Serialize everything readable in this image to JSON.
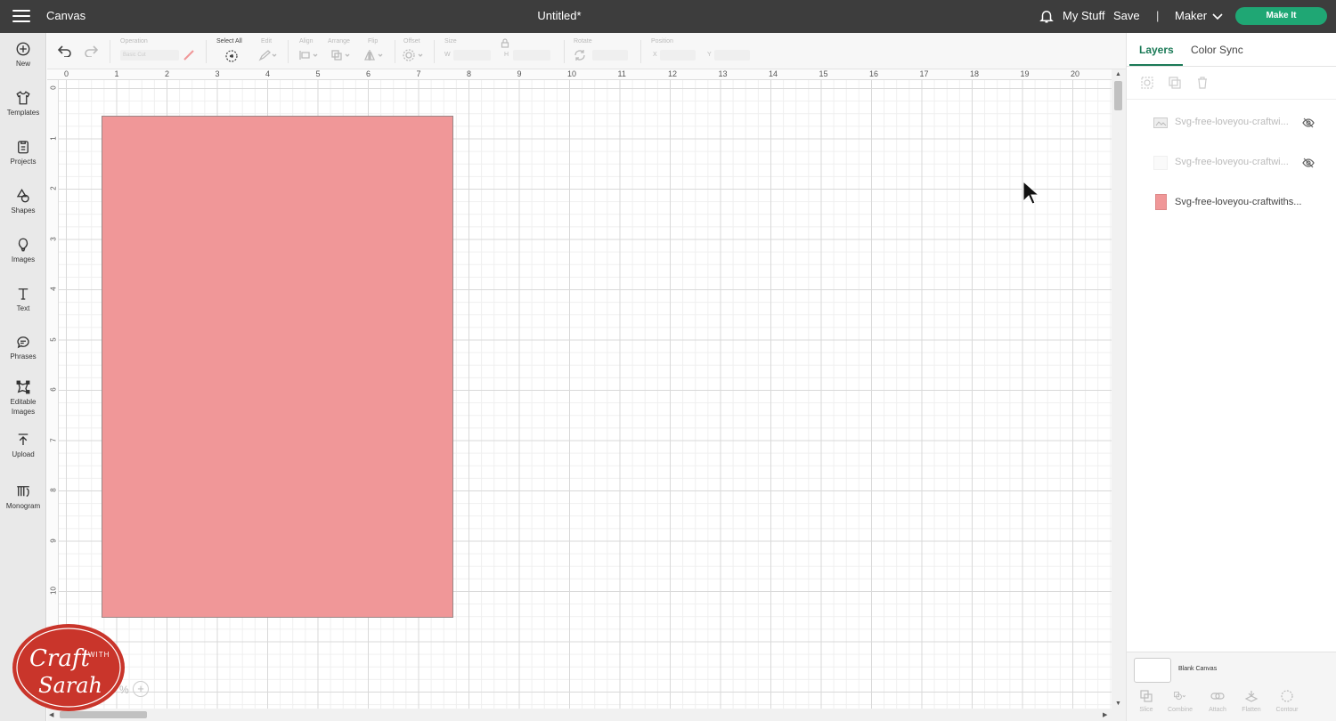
{
  "topbar": {
    "app_name": "Canvas",
    "doc_title": "Untitled*",
    "my_stuff": "My Stuff",
    "save": "Save",
    "separator": "|",
    "machine": "Maker",
    "make_it": "Make It"
  },
  "sidebar": {
    "items": [
      {
        "label": "New",
        "icon": "plus-circle-icon"
      },
      {
        "label": "Templates",
        "icon": "shirt-icon"
      },
      {
        "label": "Projects",
        "icon": "clipboard-icon"
      },
      {
        "label": "Shapes",
        "icon": "shapes-icon"
      },
      {
        "label": "Images",
        "icon": "balloon-icon"
      },
      {
        "label": "Text",
        "icon": "text-icon"
      },
      {
        "label": "Phrases",
        "icon": "speech-bubble-icon"
      },
      {
        "label": "Editable Images",
        "icon": "editable-image-icon"
      },
      {
        "label": "Upload",
        "icon": "upload-icon"
      },
      {
        "label": "Monogram",
        "icon": "monogram-icon"
      }
    ]
  },
  "toolbar": {
    "operation_label": "Operation",
    "operation_value": "Basic Cut",
    "select_all": "Select All",
    "edit": "Edit",
    "align": "Align",
    "arrange": "Arrange",
    "flip": "Flip",
    "offset": "Offset",
    "size": "Size",
    "size_w": "W",
    "size_h": "H",
    "rotate": "Rotate",
    "position": "Position",
    "pos_x": "X",
    "pos_y": "Y"
  },
  "ruler": {
    "top": [
      "0",
      "1",
      "2",
      "3",
      "4",
      "5",
      "6",
      "7",
      "8",
      "9",
      "10",
      "11",
      "12",
      "13",
      "14",
      "15",
      "16",
      "17",
      "18",
      "19",
      "20"
    ],
    "left": [
      "0",
      "1",
      "2",
      "3",
      "4",
      "5",
      "6",
      "7",
      "8",
      "9",
      "10"
    ]
  },
  "canvas": {
    "shape_color": "#f09798",
    "zoom_label": "%",
    "zoom_plus": "+"
  },
  "panel": {
    "tab_layers": "Layers",
    "tab_color_sync": "Color Sync",
    "layers": [
      {
        "name": "Svg-free-loveyou-craftwi...",
        "hidden": true,
        "icon": "image-layer-icon"
      },
      {
        "name": "Svg-free-loveyou-craftwi...",
        "hidden": true,
        "icon": "blank-layer-icon"
      },
      {
        "name": "Svg-free-loveyou-craftwiths...",
        "hidden": false,
        "color": "#f09798"
      }
    ],
    "blank_canvas": "Blank Canvas",
    "bottom_tools": [
      "Slice",
      "Combine",
      "Attach",
      "Flatten",
      "Contour"
    ]
  },
  "watermark": {
    "line1": "Craft",
    "line2": "WITH",
    "line3": "Sarah",
    "color": "#c9352b"
  },
  "colors": {
    "topbar": "#3d3d3d",
    "accent_green": "#1fa774",
    "tab_green": "#1b7a57"
  }
}
